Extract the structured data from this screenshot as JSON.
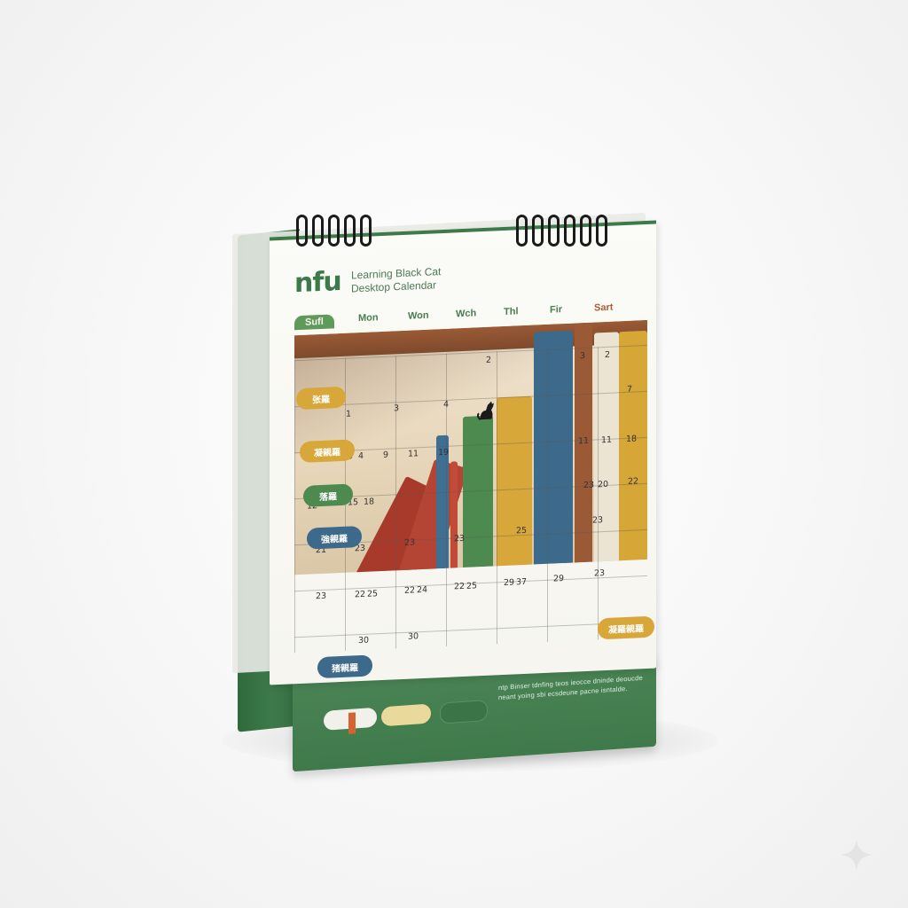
{
  "calendar": {
    "logo": "nfu",
    "subtitle_line1": "Learning Black Cat",
    "subtitle_line2": "Desktop Calendar",
    "days": [
      "Sufl",
      "Mon",
      "Won",
      "Wch",
      "Thl",
      "Fir",
      "Sart"
    ],
    "grid_numbers": [
      "2",
      "3",
      "2",
      "7",
      "1",
      "3",
      "4",
      "9",
      "4",
      "9",
      "11",
      "19",
      "11",
      "11",
      "18",
      "12",
      "15",
      "18",
      "23",
      "20",
      "22",
      "21",
      "23",
      "23",
      "23",
      "25",
      "23",
      "23",
      "22",
      "25",
      "22",
      "24",
      "22",
      "25",
      "29",
      "37",
      "29",
      "23",
      "30",
      "30"
    ],
    "event_tags": [
      "张羅",
      "凝親羅",
      "落羅",
      "強親羅",
      "猪親羅",
      "凝羅親羅"
    ]
  },
  "base": {
    "text_line1": "ntp Binser tdnfing teos ieocce dninde deoucde",
    "text_line2": "neant yoing sbi ecsdeune pacne isntalde."
  },
  "colors": {
    "green": "#3d7a4a",
    "yellow": "#d8a73a",
    "blue": "#3d6a8a",
    "red": "#a83a2c"
  }
}
